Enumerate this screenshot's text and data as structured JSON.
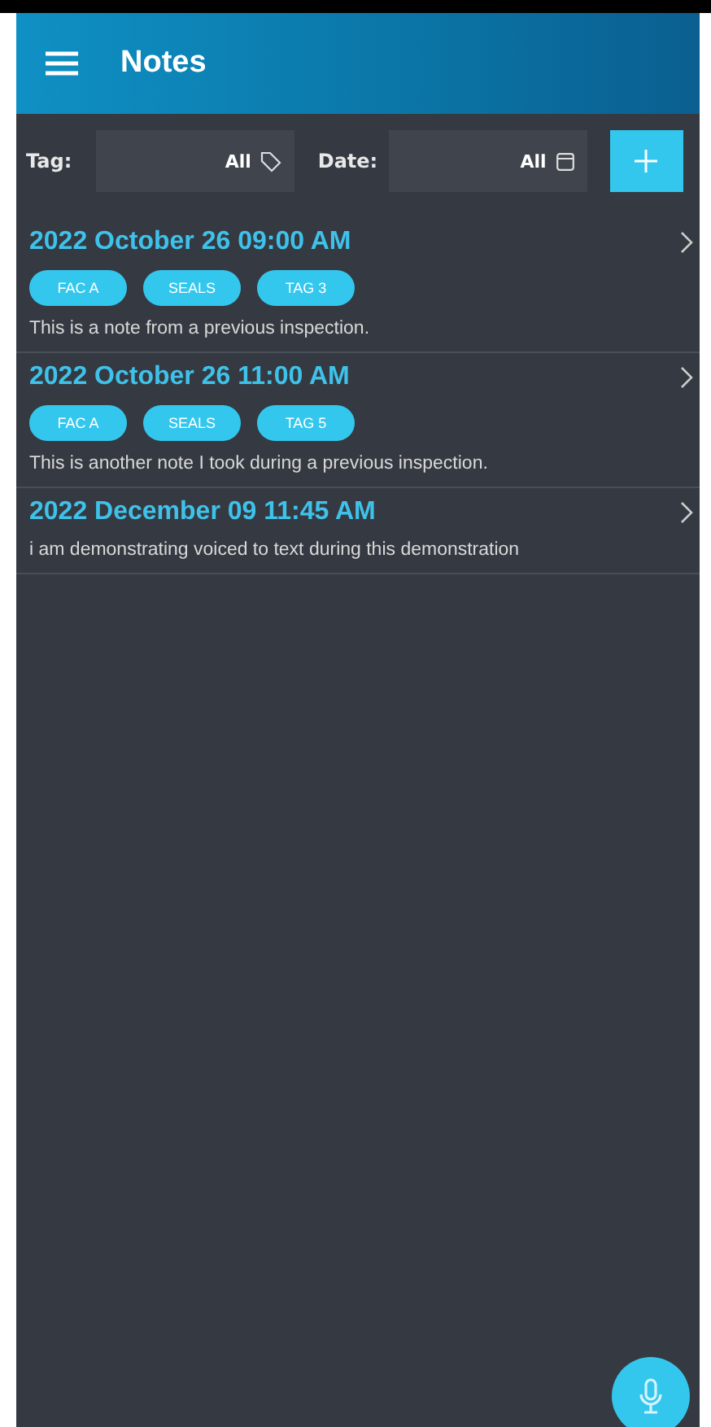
{
  "app_bar": {
    "title": "Notes"
  },
  "filters": [
    {
      "label": "Tag:",
      "value": "All",
      "kind": "tag"
    },
    {
      "label": "Date:",
      "value": "All",
      "kind": "date"
    }
  ],
  "notes": [
    {
      "title": "2022 October 26 09:00 AM",
      "tags": [
        "FAC A",
        "SEALS",
        "TAG 3"
      ],
      "text": "This is a note from a previous inspection."
    },
    {
      "title": "2022 October 26 11:00 AM",
      "tags": [
        "FAC A",
        "SEALS",
        "TAG 5"
      ],
      "text": "This is another note I took during a previous inspection."
    },
    {
      "title": "2022 December 09 11:45 AM",
      "text": "i am demonstrating voiced to text during this demonstration"
    }
  ]
}
